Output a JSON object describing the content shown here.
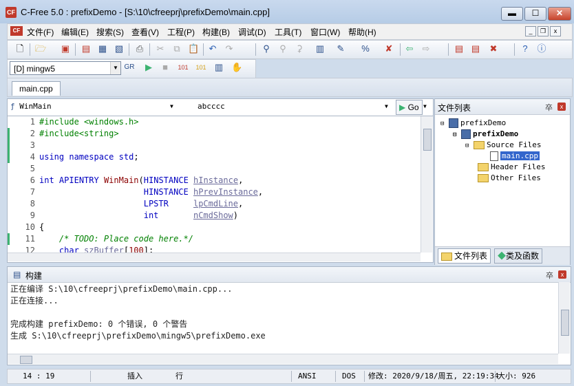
{
  "window": {
    "title": "C-Free 5.0 : prefixDemo - [S:\\10\\cfreeprj\\prefixDemo\\main.cpp]",
    "logo_text": "CF",
    "minimize": "▬",
    "maximize": "☐",
    "close": "✕"
  },
  "menu": {
    "items": [
      "文件(F)",
      "编辑(E)",
      "搜索(S)",
      "查看(V)",
      "工程(P)",
      "构建(B)",
      "调试(D)",
      "工具(T)",
      "窗口(W)",
      "帮助(H)"
    ],
    "mdi_minimize": "_",
    "mdi_restore": "❐",
    "mdi_close": "x"
  },
  "toolbar": {
    "compiler": "[D] mingw5",
    "icons": [
      "new-file",
      "open",
      "open-project",
      "save",
      "save-all",
      "print",
      "cut",
      "copy",
      "paste",
      "undo",
      "redo",
      "find",
      "replace",
      "goto",
      "compile",
      "build",
      "stop",
      "help",
      "info"
    ]
  },
  "tabs": [
    {
      "label": "main.cpp"
    }
  ],
  "editor": {
    "function_combo": "WinMain",
    "symbol_combo": "abcccc",
    "go_label": "Go",
    "lines": [
      {
        "no": "1",
        "text": "#include <windows.h>",
        "mark": false
      },
      {
        "no": "2",
        "text": "#include<string>",
        "mark": true
      },
      {
        "no": "3",
        "text": "",
        "mark": true
      },
      {
        "no": "4",
        "text": "using namespace std;",
        "mark": true
      },
      {
        "no": "5",
        "text": "",
        "mark": false
      },
      {
        "no": "6",
        "text": "int APIENTRY WinMain(HINSTANCE hInstance,",
        "mark": false
      },
      {
        "no": "7",
        "text": "                     HINSTANCE hPrevInstance,",
        "mark": false
      },
      {
        "no": "8",
        "text": "                     LPSTR     lpCmdLine,",
        "mark": false
      },
      {
        "no": "9",
        "text": "                     int       nCmdShow)",
        "mark": false
      },
      {
        "no": "10",
        "text": "{",
        "mark": false
      },
      {
        "no": "11",
        "text": "    /* TODO: Place code here.*/",
        "mark": true
      },
      {
        "no": "12",
        "text": "    char szBuffer[100];",
        "mark": false
      }
    ]
  },
  "filepanel": {
    "title": "文件列表",
    "pin": "卒",
    "root": "prefixDemo",
    "project": "prefixDemo",
    "folders": [
      "Source Files",
      "Header Files",
      "Other Files"
    ],
    "selected_file": "main.cpp",
    "tab_files": "文件列表",
    "tab_classes": "类及函数"
  },
  "build": {
    "title": "构建",
    "lines": [
      "正在编译 S:\\10\\cfreeprj\\prefixDemo\\main.cpp...",
      "正在连接...",
      "",
      "完成构建 prefixDemo: 0 个错误, 0 个警告",
      "生成 S:\\10\\cfreeprj\\prefixDemo\\mingw5\\prefixDemo.exe"
    ]
  },
  "status": {
    "position": "14 : 19",
    "mode": "插入",
    "unit": "行",
    "encoding": "ANSI",
    "lineend": "DOS",
    "modified": "修改: 2020/9/18/周五, 22:19:34",
    "size": "大小: 926"
  }
}
